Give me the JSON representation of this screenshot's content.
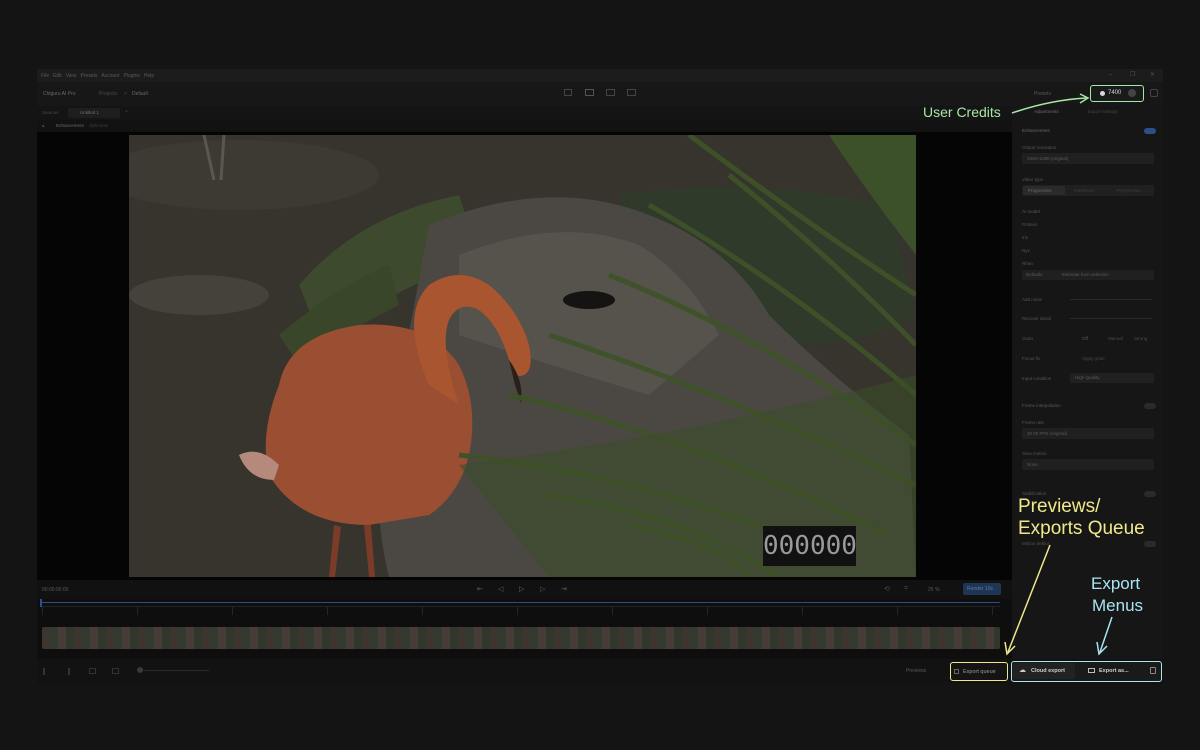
{
  "menu": [
    "File",
    "Edit",
    "View",
    "Presets",
    "Account",
    "Plugins",
    "Help"
  ],
  "window_controls": [
    "–",
    "❐",
    "✕"
  ],
  "titlebar": {
    "app_name": "Chiguru AI Pro",
    "breadcrumb_project": "Projects",
    "breadcrumb_sep": ">",
    "breadcrumb_current": "Default",
    "presets_label": "Presets",
    "credits_value": "7400"
  },
  "tabs": {
    "sources": "Sources",
    "active_tab": "Untitled 1",
    "add": "+"
  },
  "viewer": {
    "header_label": "Enhancement",
    "header_sub": "Split view",
    "timecode": "000000",
    "time_readout": "00:00:00:00",
    "zoom_label": "25 %",
    "render_label": "Render 10s"
  },
  "right_panel": {
    "tabs": [
      "Adjustments",
      "Export settings"
    ],
    "enhancement_label": "Enhancement",
    "output_resolution_label": "Output resolution",
    "output_resolution_value": "1920×1080 (original)",
    "video_type_label": "Video type",
    "video_type_options": [
      "Progressive",
      "Interlaced",
      "Progressive ..."
    ],
    "ai_model_label": "AI model",
    "model_rows": [
      "Proteus",
      "Iris",
      "Nyx",
      "Rhea"
    ],
    "model_buttons": [
      "Defaults",
      "Estimate from selection"
    ],
    "slider_labels": [
      "Add noise",
      "Recover detail"
    ],
    "grain_label": "Grain",
    "grain_options": [
      "Off",
      "Manual",
      "Strong"
    ],
    "grain_apply": "Apply grain",
    "focus_label": "Focus fix",
    "quality_label": "Input condition",
    "quality_value": "High Quality",
    "frame_interp_label": "Frame interpolation",
    "frame_rate_label": "Frame rate",
    "frame_rate_value": "30.00 FPS (original)",
    "slow_motion_label": "Slow motion",
    "slow_motion_value": "None",
    "stabilize_label": "Stabilization",
    "motion_label": "Motion deblur"
  },
  "bottom": {
    "preview_label": "Previews",
    "export_queue": "Export queue",
    "cloud_export": "Cloud export",
    "export_as": "Export as..."
  },
  "annotations": {
    "user_credits": "User Credits",
    "previews_queue_line1": "Previews/",
    "previews_queue_line2": "Exports Queue",
    "export_menus_line1": "Export",
    "export_menus_line2": "Menus"
  },
  "colors": {
    "credits_annotation": "#a6e8a6",
    "queue_annotation": "#f0e98a",
    "export_annotation": "#a8e4f2"
  },
  "icons": [
    "window-minimize-icon",
    "window-restore-icon",
    "window-close-icon",
    "view-single-icon",
    "view-split-icon",
    "view-side-icon",
    "view-compare-icon",
    "play-icon",
    "prev-frame-icon",
    "next-frame-icon",
    "skip-start-icon",
    "skip-end-icon",
    "cloud-icon",
    "folder-icon",
    "lock-icon",
    "queue-icon",
    "user-avatar-icon",
    "coin-icon"
  ]
}
